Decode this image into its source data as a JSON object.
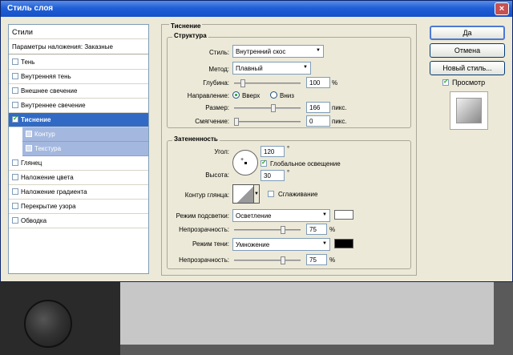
{
  "window": {
    "title": "Стиль слоя",
    "close": "×"
  },
  "styles_list": {
    "header": "Стили",
    "blending": "Параметры наложения: Заказные",
    "items": [
      {
        "label": "Тень",
        "checked": false
      },
      {
        "label": "Внутренняя тень",
        "checked": false
      },
      {
        "label": "Внешнее свечение",
        "checked": false
      },
      {
        "label": "Внутреннее свечение",
        "checked": false
      },
      {
        "label": "Тиснение",
        "checked": true
      },
      {
        "label": "Контур",
        "checked": false
      },
      {
        "label": "Текстура",
        "checked": false
      },
      {
        "label": "Глянец",
        "checked": false
      },
      {
        "label": "Наложение цвета",
        "checked": false
      },
      {
        "label": "Наложение градиента",
        "checked": false
      },
      {
        "label": "Перекрытие узора",
        "checked": false
      },
      {
        "label": "Обводка",
        "checked": false
      }
    ]
  },
  "bevel": {
    "title": "Тиснение",
    "structure": {
      "title": "Структура",
      "style_label": "Стиль:",
      "style_value": "Внутренний скос",
      "technique_label": "Метод:",
      "technique_value": "Плавный",
      "depth_label": "Глубина:",
      "depth_value": "100",
      "depth_unit": "%",
      "depth_level": 0.1,
      "direction_label": "Направление:",
      "direction_up": "Вверх",
      "direction_down": "Вниз",
      "size_label": "Размер:",
      "size_value": "166",
      "size_unit": "пикс.",
      "size_level": 0.6,
      "soften_label": "Смягчение:",
      "soften_value": "0",
      "soften_unit": "пикс.",
      "soften_level": 0.0
    },
    "shading": {
      "title": "Затененность",
      "angle_label": "Угол:",
      "angle_value": "120",
      "angle_unit": "°",
      "global_light": "Глобальное освещение",
      "altitude_label": "Высота:",
      "altitude_value": "30",
      "altitude_unit": "°",
      "gloss_label": "Контур глянца:",
      "antialias": "Сглаживание",
      "highlight_label": "Режим подсветки:",
      "highlight_value": "Осветление",
      "highlight_color": "#ffffff",
      "opacity_label": "Непрозрачность:",
      "highlight_opacity": "75",
      "highlight_opacity_level": 0.75,
      "shadow_label": "Режим тени:",
      "shadow_value": "Умножение",
      "shadow_color": "#000000",
      "shadow_opacity": "75",
      "shadow_opacity_level": 0.75,
      "pct": "%"
    }
  },
  "buttons": {
    "ok": "Да",
    "cancel": "Отмена",
    "new_style": "Новый стиль...",
    "preview": "Просмотр"
  }
}
